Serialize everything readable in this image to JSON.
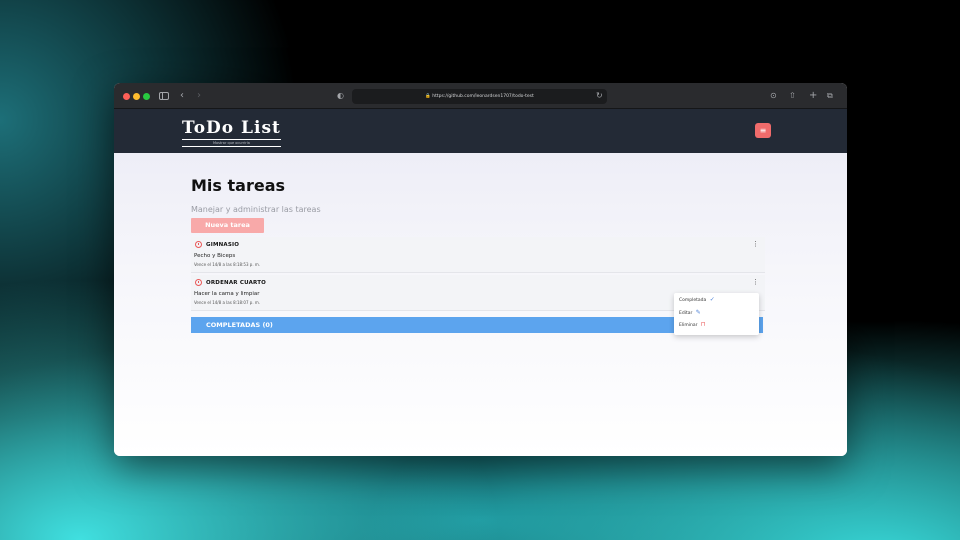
{
  "browser": {
    "url": "https://github.com/leonardsen1707/todo-test"
  },
  "app": {
    "logo_title": "ToDo List",
    "logo_subtitle": "Mostrar que ocurriría",
    "menu_icon": "menu-list-icon",
    "brand_color": "#232a36",
    "accent_color": "#f06b6b"
  },
  "main": {
    "title": "Mis tareas",
    "subtitle": "Manejar y administrar las tareas",
    "new_task_label": "Nueva tarea",
    "tasks": [
      {
        "title": "GIMNASIO",
        "description": "Pecho y Biceps",
        "date": "Vence el 14/8 a las 8:18:53 p. m."
      },
      {
        "title": "ORDENAR CUARTO",
        "description": "Hacer la cama y limpiar",
        "date": "Vence el 14/8 a las 8:18:07 p. m."
      }
    ],
    "completed_label": "COMPLETADAS (0)",
    "completed_color": "#5ca4ee"
  },
  "dropdown": {
    "items": [
      {
        "label": "Completada",
        "icon": "check-icon",
        "glyph": "✓"
      },
      {
        "label": "Editar",
        "icon": "edit-icon",
        "glyph": "✎"
      },
      {
        "label": "Eliminar",
        "icon": "trash-icon",
        "glyph": "🗑"
      }
    ]
  }
}
